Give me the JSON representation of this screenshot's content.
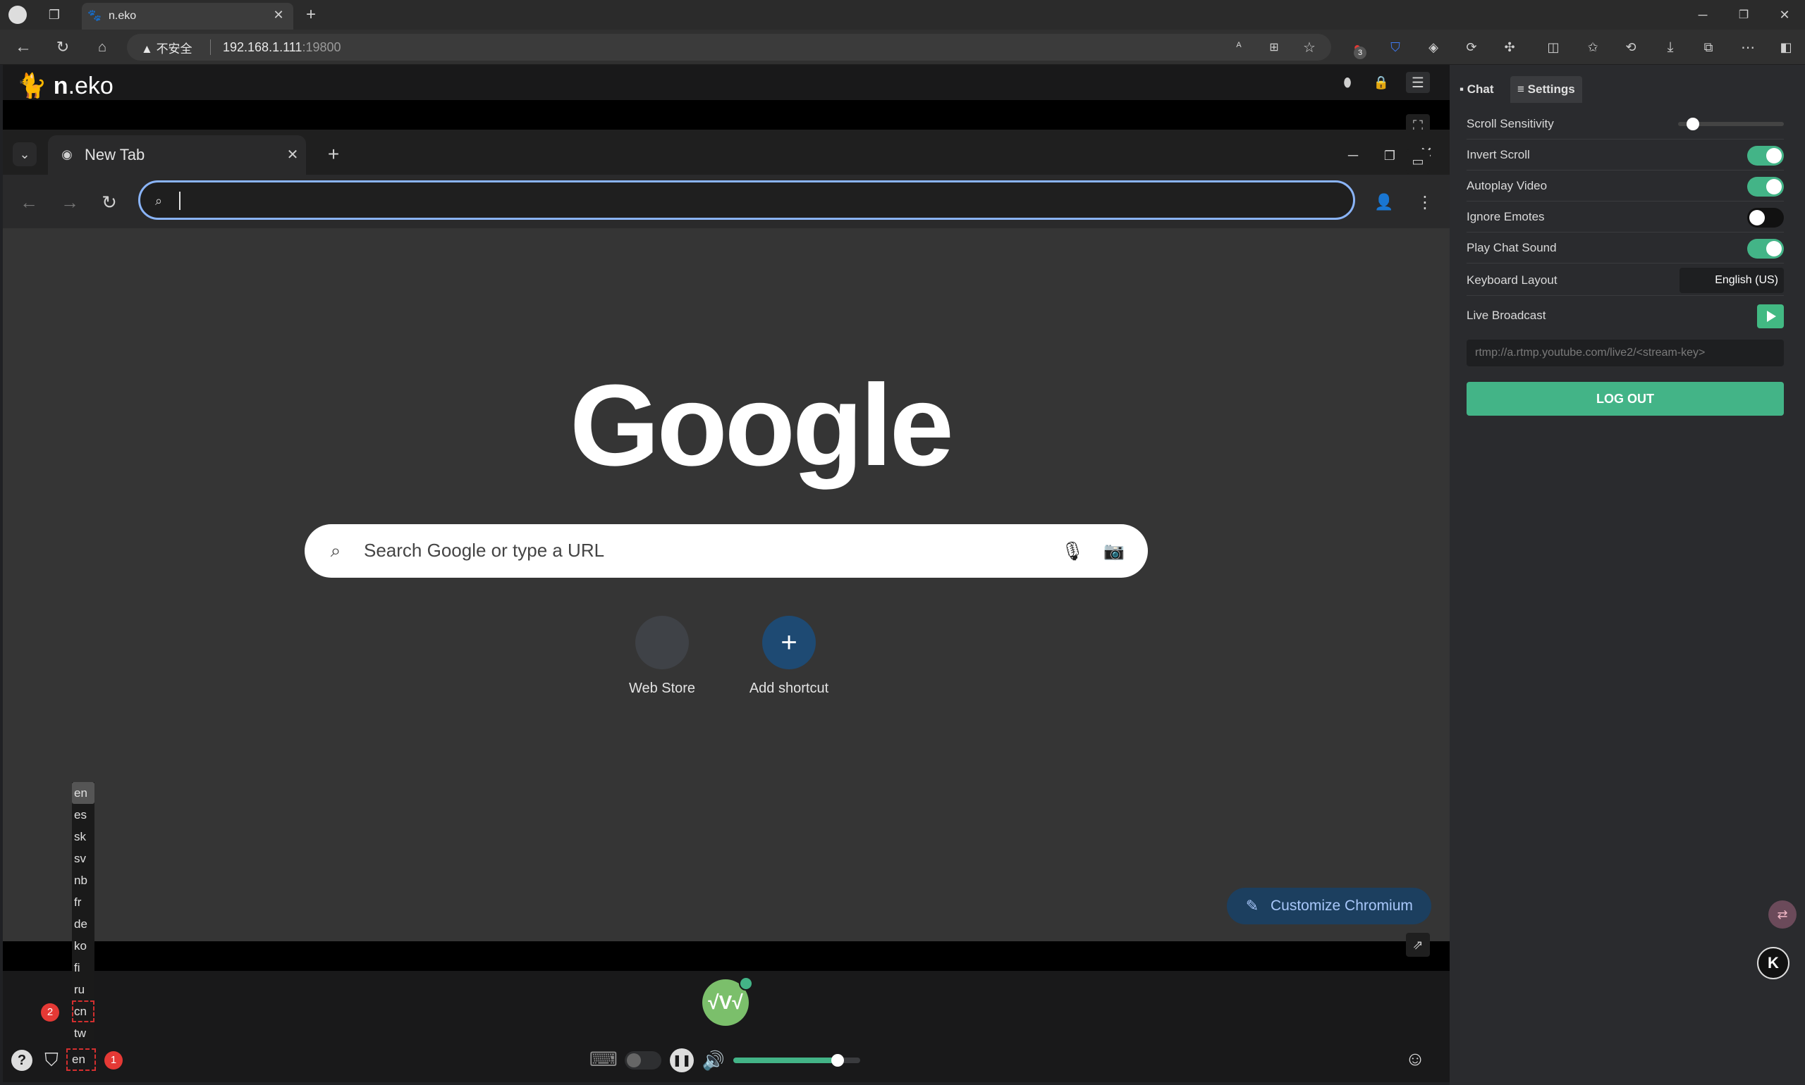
{
  "host_browser": {
    "tab_title": "n.eko",
    "security_warning": "不安全",
    "url_host": "192.168.1.111",
    "url_port": ":19800",
    "extension_badge_count": "3"
  },
  "neko": {
    "logo_bold": "n",
    "logo_rest": ".eko"
  },
  "inner_browser": {
    "tab_title": "New Tab",
    "google_logo": "Google",
    "search_placeholder": "Search Google or type a URL",
    "shortcuts": [
      {
        "label": "Web Store",
        "icon": "web-store-icon"
      },
      {
        "label": "Add shortcut",
        "icon": "plus-icon"
      }
    ],
    "customize_label": "Customize Chromium"
  },
  "controls": {
    "avatar_text": "√V√",
    "volume_level": 0.82,
    "language_options": [
      "en",
      "es",
      "sk",
      "sv",
      "nb",
      "fr",
      "de",
      "ko",
      "fi",
      "ru",
      "cn",
      "tw"
    ],
    "language_selected": "en",
    "language_current": "en",
    "annotation_1": "1",
    "annotation_2": "2"
  },
  "sidebar": {
    "tabs": [
      {
        "label": "Chat",
        "active": false
      },
      {
        "label": "Settings",
        "active": true
      }
    ],
    "scroll_sensitivity_label": "Scroll Sensitivity",
    "scroll_sensitivity_value": 0.05,
    "settings": [
      {
        "label": "Invert Scroll",
        "on": true
      },
      {
        "label": "Autoplay Video",
        "on": true
      },
      {
        "label": "Ignore Emotes",
        "on": false
      },
      {
        "label": "Play Chat Sound",
        "on": true
      }
    ],
    "keyboard_layout_label": "Keyboard Layout",
    "keyboard_layout_value": "English (US)",
    "live_broadcast_label": "Live Broadcast",
    "rtmp_placeholder": "rtmp://a.rtmp.youtube.com/live2/<stream-key>",
    "logout_label": "LOG OUT"
  },
  "colors": {
    "accent_green": "#43b487",
    "toggle_on": "#43b487",
    "toggle_off": "#111111"
  }
}
